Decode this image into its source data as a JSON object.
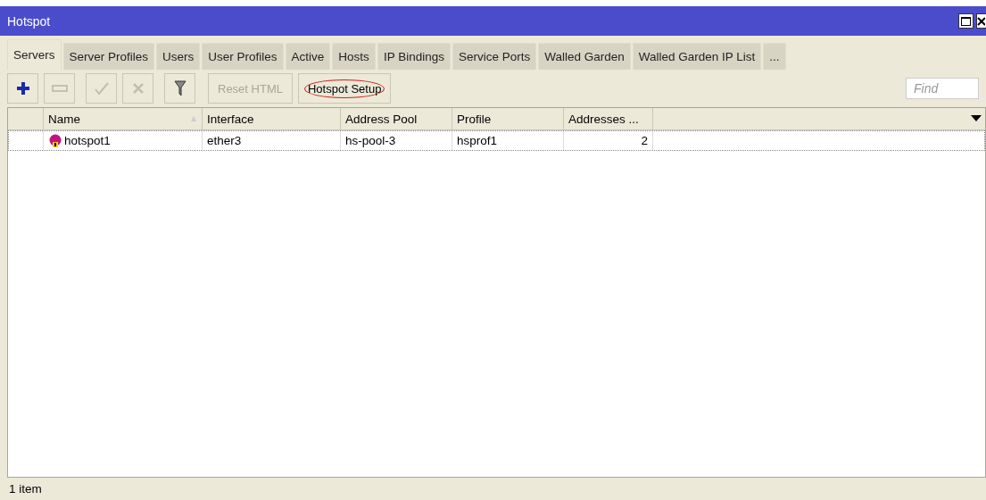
{
  "window": {
    "title": "Hotspot"
  },
  "tabs": [
    {
      "label": "Servers",
      "selected": true
    },
    {
      "label": "Server Profiles",
      "selected": false
    },
    {
      "label": "Users",
      "selected": false
    },
    {
      "label": "User Profiles",
      "selected": false
    },
    {
      "label": "Active",
      "selected": false
    },
    {
      "label": "Hosts",
      "selected": false
    },
    {
      "label": "IP Bindings",
      "selected": false
    },
    {
      "label": "Service Ports",
      "selected": false
    },
    {
      "label": "Walled Garden",
      "selected": false
    },
    {
      "label": "Walled Garden IP List",
      "selected": false
    },
    {
      "label": "...",
      "selected": false
    }
  ],
  "toolbar": {
    "icon_buttons": [
      {
        "disabled": false
      },
      {
        "disabled": true
      },
      {
        "disabled": true
      },
      {
        "disabled": true
      },
      {
        "disabled": false
      }
    ],
    "text_buttons": [
      {
        "label": "Reset HTML",
        "disabled": true,
        "highlighted": false
      },
      {
        "label": "Hotspot Setup",
        "disabled": false,
        "highlighted": true
      }
    ],
    "search": {
      "placeholder": "Find"
    }
  },
  "table": {
    "columns": [
      {
        "label": "Name",
        "sorted": true
      },
      {
        "label": "Interface",
        "sorted": false
      },
      {
        "label": "Address Pool",
        "sorted": false
      },
      {
        "label": "Profile",
        "sorted": false
      },
      {
        "label": "Addresses ...",
        "sorted": false
      }
    ],
    "rows": [
      {
        "cells": [
          "hotspot1",
          "ether3",
          "hs-pool-3",
          "hsprof1",
          "2"
        ],
        "selected": false
      }
    ]
  },
  "status_bar": "1 item"
}
